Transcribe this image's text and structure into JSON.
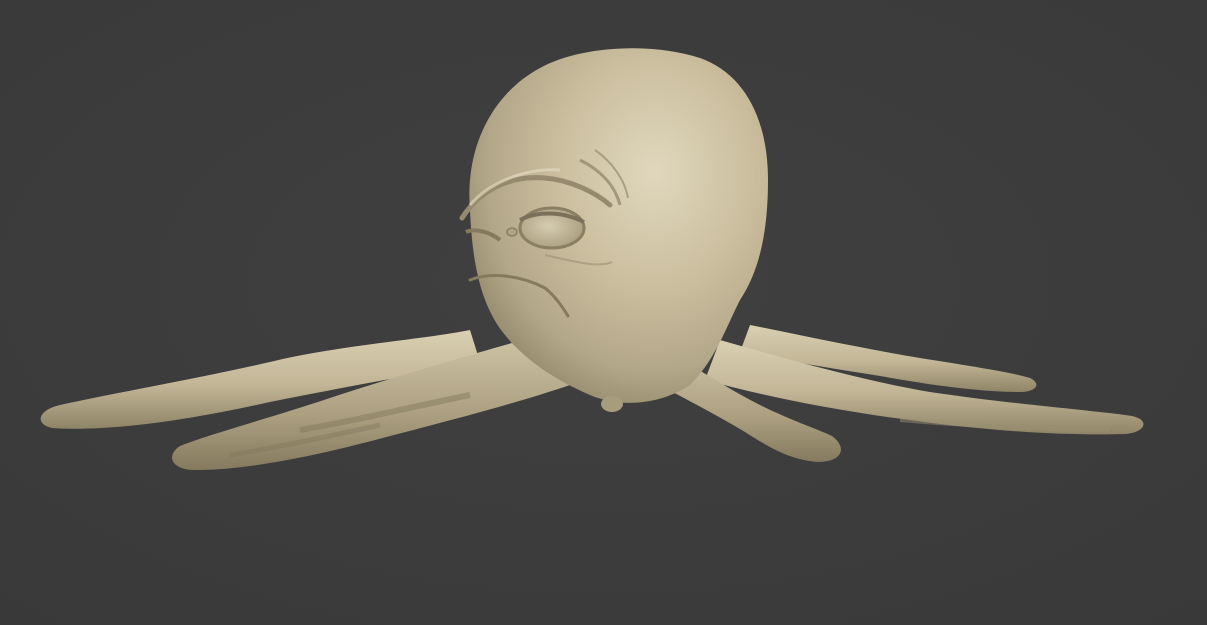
{
  "viewport": {
    "background_color": "#3d3d3d",
    "model_color": "#cbbf9f",
    "model_shadow_color": "#8f8467",
    "model_highlight_color": "#e0d7bd",
    "shading": "matcap-clay",
    "subject": "sculpted-octopus-model"
  }
}
